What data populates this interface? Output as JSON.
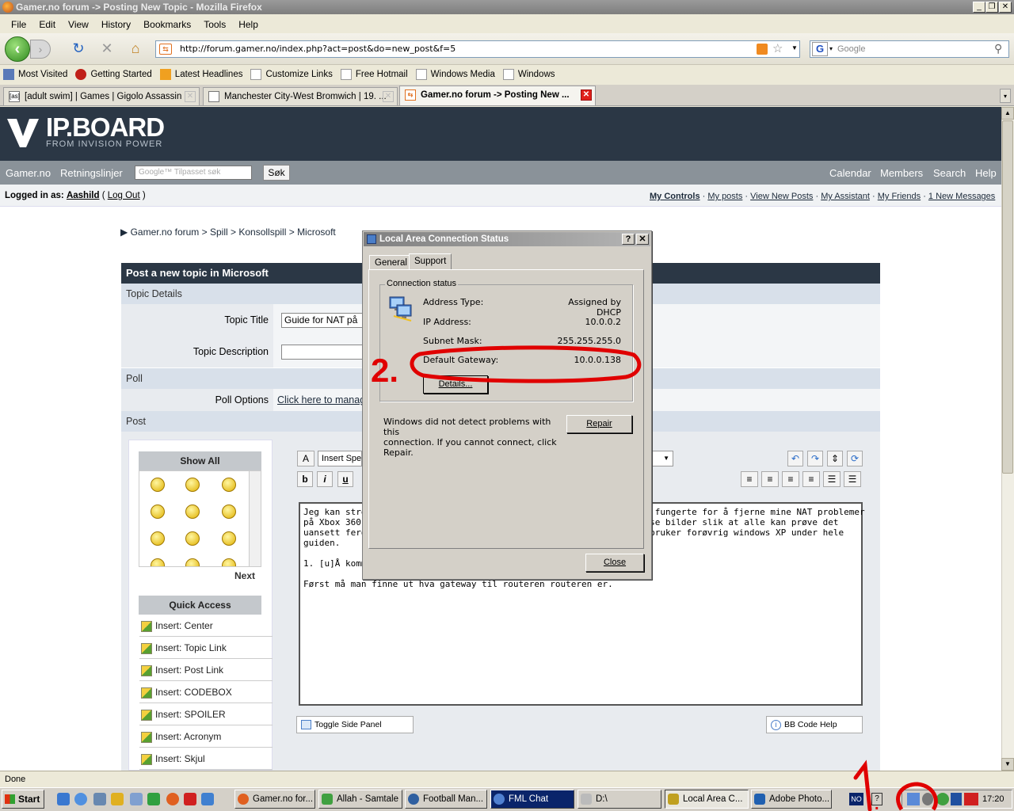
{
  "window": {
    "title": "Gamer.no forum -> Posting New Topic - Mozilla Firefox"
  },
  "menu": [
    "File",
    "Edit",
    "View",
    "History",
    "Bookmarks",
    "Tools",
    "Help"
  ],
  "address": {
    "url": "http://forum.gamer.no/index.php?act=post&do=new_post&f=5",
    "search_placeholder": "Google"
  },
  "bookmarks": [
    "Most Visited",
    "Getting Started",
    "Latest Headlines",
    "Customize Links",
    "Free Hotmail",
    "Windows Media",
    "Windows"
  ],
  "tabs": [
    {
      "label": "[adult swim] | Games | Gigolo Assassin",
      "icon": "[as]"
    },
    {
      "label": "Manchester City-West Bromwich | 19. ...",
      "icon": ""
    },
    {
      "label": "Gamer.no forum -> Posting New ...",
      "icon": ""
    }
  ],
  "ipb": {
    "logo_title": "IP.BOARD",
    "logo_sub": "FROM INVISION POWER",
    "nav_left": [
      "Gamer.no",
      "Retningslinjer"
    ],
    "search_placeholder": "Google™ Tilpasset søk",
    "search_button": "Søk",
    "nav_right": [
      "Calendar",
      "Members",
      "Search",
      "Help"
    ],
    "logged_in_label": "Logged in as:",
    "username": "Aashild",
    "logout": "Log Out",
    "user_links": [
      "My Controls",
      "My posts",
      "View New Posts",
      "My Assistant",
      "My Friends",
      "1 New Messages"
    ]
  },
  "breadcrumb": [
    "Gamer.no forum",
    "Spill",
    "Konsollspill",
    "Microsoft"
  ],
  "post": {
    "header": "Post a new topic in Microsoft",
    "topic_details": "Topic Details",
    "topic_title_label": "Topic Title",
    "topic_title_value": "Guide for NAT på",
    "topic_desc_label": "Topic Description",
    "poll": "Poll",
    "poll_options_label": "Poll Options",
    "poll_options_link": "Click here to manag",
    "post_section": "Post",
    "show_all": "Show All",
    "next": "Next",
    "quick_access": "Quick Access",
    "quick_items": [
      "Insert: Center",
      "Insert: Topic Link",
      "Insert: Post Link",
      "Insert: CODEBOX",
      "Insert: SPOILER",
      "Insert: Acronym",
      "Insert: Skjul"
    ],
    "insert_special": "Insert Spe",
    "editor_lines": [
      "Jeg kan stren                                                   et fungerte for å fjerne mine NAT problemer",
      "på Xbox 360.                                                   masse bilder slik at alle kan prøve det",
      "uansett ferdi                                                  eg bruker forøvrig windows XP under hele",
      "guiden.",
      "",
      "1. [u]Å komm",
      "",
      "Først må man finne ut hva gateway til routeren routeren er."
    ],
    "toggle_side": "Toggle Side Panel",
    "bb_help": "BB Code Help"
  },
  "dialog": {
    "title": "Local Area Connection Status",
    "help_btn": "?",
    "close_x": "✕",
    "tab_general": "General",
    "tab_support": "Support",
    "group_label": "Connection status",
    "rows": [
      {
        "k": "Address Type:",
        "v": "Assigned by DHCP"
      },
      {
        "k": "IP Address:",
        "v": "10.0.0.2"
      },
      {
        "k": "Subnet Mask:",
        "v": "255.255.255.0"
      },
      {
        "k": "Default Gateway:",
        "v": "10.0.0.138"
      }
    ],
    "details_btn": "Details...",
    "message": [
      "Windows did not detect problems with this",
      "connection. If you cannot connect, click",
      "Repair."
    ],
    "repair_btn": "Repair",
    "close_btn": "Close"
  },
  "status": "Done",
  "taskbar": {
    "start": "Start",
    "buttons": [
      "Gamer.no for...",
      "Allah - Samtale",
      "Football Man...",
      "FML Chat",
      "D:\\",
      "Local Area C...",
      "Adobe Photo..."
    ],
    "lang": "NO",
    "clock": "17:20"
  },
  "annotations": [
    "2.",
    "1."
  ],
  "colors": {
    "ipb_dark": "#2b3745",
    "ipb_nav": "#8a9299",
    "annotation_red": "#e00000",
    "fml_blue": "#0a246a"
  }
}
